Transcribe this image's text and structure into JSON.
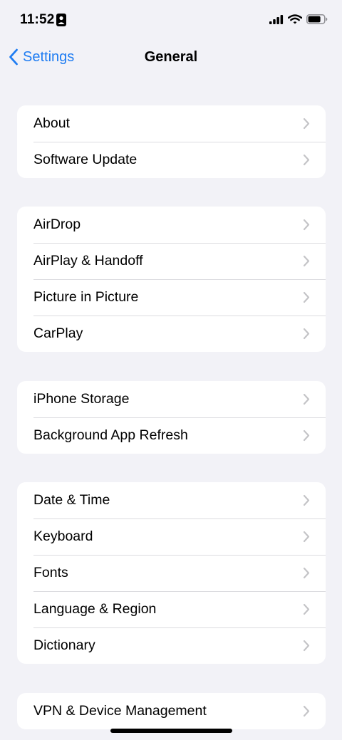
{
  "status_bar": {
    "time": "11:52",
    "icons": [
      "person-card-icon",
      "cellular-signal-icon",
      "wifi-icon",
      "battery-icon"
    ]
  },
  "nav": {
    "back_label": "Settings",
    "title": "General"
  },
  "groups": [
    {
      "items": [
        {
          "label": "About"
        },
        {
          "label": "Software Update"
        }
      ]
    },
    {
      "items": [
        {
          "label": "AirDrop"
        },
        {
          "label": "AirPlay & Handoff"
        },
        {
          "label": "Picture in Picture"
        },
        {
          "label": "CarPlay"
        }
      ]
    },
    {
      "items": [
        {
          "label": "iPhone Storage"
        },
        {
          "label": "Background App Refresh"
        }
      ]
    },
    {
      "items": [
        {
          "label": "Date & Time"
        },
        {
          "label": "Keyboard"
        },
        {
          "label": "Fonts"
        },
        {
          "label": "Language & Region"
        },
        {
          "label": "Dictionary"
        }
      ]
    },
    {
      "items": [
        {
          "label": "VPN & Device Management"
        }
      ]
    }
  ],
  "colors": {
    "accent": "#1e7cf2",
    "background": "#f2f2f7",
    "card": "#ffffff",
    "chevron": "#c4c4c7"
  }
}
